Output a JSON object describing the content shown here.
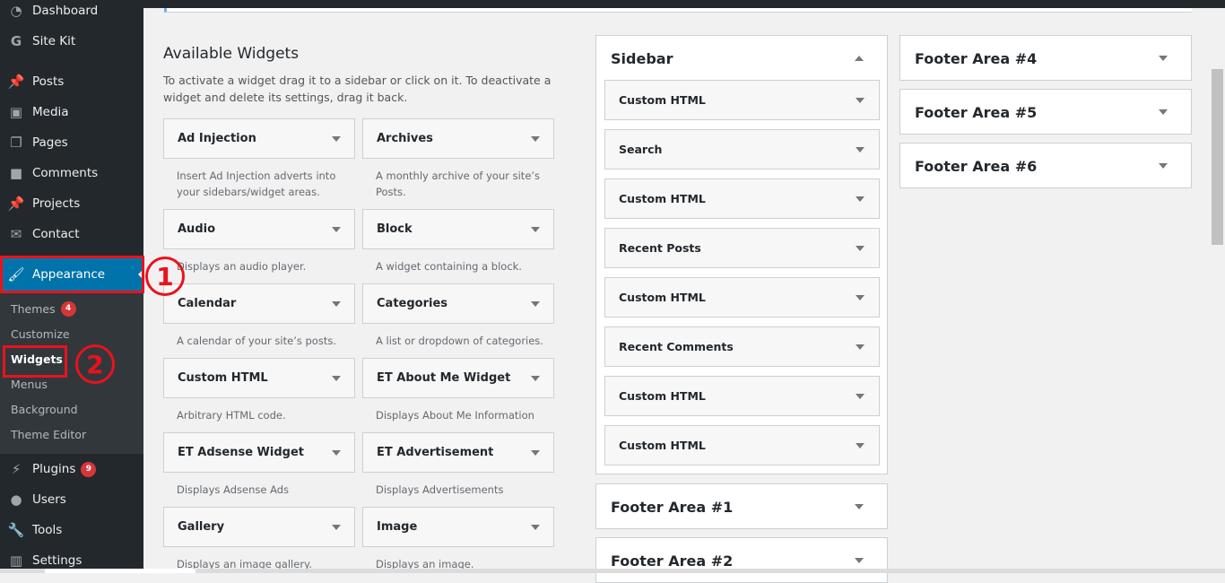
{
  "menu": {
    "items": [
      {
        "label": "Dashboard",
        "icon": "dashboard-icon"
      },
      {
        "label": "Site Kit",
        "icon": "google-g-icon"
      },
      {
        "label": "Posts",
        "icon": "pin-icon"
      },
      {
        "label": "Media",
        "icon": "media-icon"
      },
      {
        "label": "Pages",
        "icon": "pages-icon"
      },
      {
        "label": "Comments",
        "icon": "comment-icon"
      },
      {
        "label": "Projects",
        "icon": "pin-icon"
      },
      {
        "label": "Contact",
        "icon": "envelope-icon"
      },
      {
        "label": "Appearance",
        "icon": "paintbrush-icon"
      },
      {
        "label": "Plugins",
        "icon": "plug-icon",
        "badge": "9"
      },
      {
        "label": "Users",
        "icon": "user-icon"
      },
      {
        "label": "Tools",
        "icon": "wrench-icon"
      },
      {
        "label": "Settings",
        "icon": "sliders-icon"
      }
    ],
    "submenu": [
      {
        "label": "Themes",
        "badge": "4"
      },
      {
        "label": "Customize"
      },
      {
        "label": "Widgets"
      },
      {
        "label": "Menus"
      },
      {
        "label": "Background"
      },
      {
        "label": "Theme Editor"
      }
    ]
  },
  "annotations": {
    "step1": "1",
    "step2": "2",
    "color": "#e8131d"
  },
  "available": {
    "title": "Available Widgets",
    "description": "To activate a widget drag it to a sidebar or click on it. To deactivate a widget and delete its settings, drag it back.",
    "widgets": [
      {
        "name": "Ad Injection",
        "desc": "Insert Ad Injection adverts into your sidebars/widget areas."
      },
      {
        "name": "Archives",
        "desc": "A monthly archive of your site’s Posts."
      },
      {
        "name": "Audio",
        "desc": "Displays an audio player."
      },
      {
        "name": "Block",
        "desc": "A widget containing a block."
      },
      {
        "name": "Calendar",
        "desc": "A calendar of your site’s posts."
      },
      {
        "name": "Categories",
        "desc": "A list or dropdown of categories."
      },
      {
        "name": "Custom HTML",
        "desc": "Arbitrary HTML code."
      },
      {
        "name": "ET About Me Widget",
        "desc": "Displays About Me Information"
      },
      {
        "name": "ET Adsense Widget",
        "desc": "Displays Adsense Ads"
      },
      {
        "name": "ET Advertisement",
        "desc": "Displays Advertisements"
      },
      {
        "name": "Gallery",
        "desc": "Displays an image gallery."
      },
      {
        "name": "Image",
        "desc": "Displays an image."
      }
    ]
  },
  "sidebar": {
    "title": "Sidebar",
    "widgets": [
      "Custom HTML",
      "Search",
      "Custom HTML",
      "Recent Posts",
      "Custom HTML",
      "Recent Comments",
      "Custom HTML",
      "Custom HTML"
    ]
  },
  "areas": [
    "Footer Area #1",
    "Footer Area #2",
    "Footer Area #4",
    "Footer Area #5",
    "Footer Area #6"
  ],
  "colors": {
    "admin_menu": "#23282d",
    "active": "#0073aa",
    "badge": "#d63638"
  }
}
